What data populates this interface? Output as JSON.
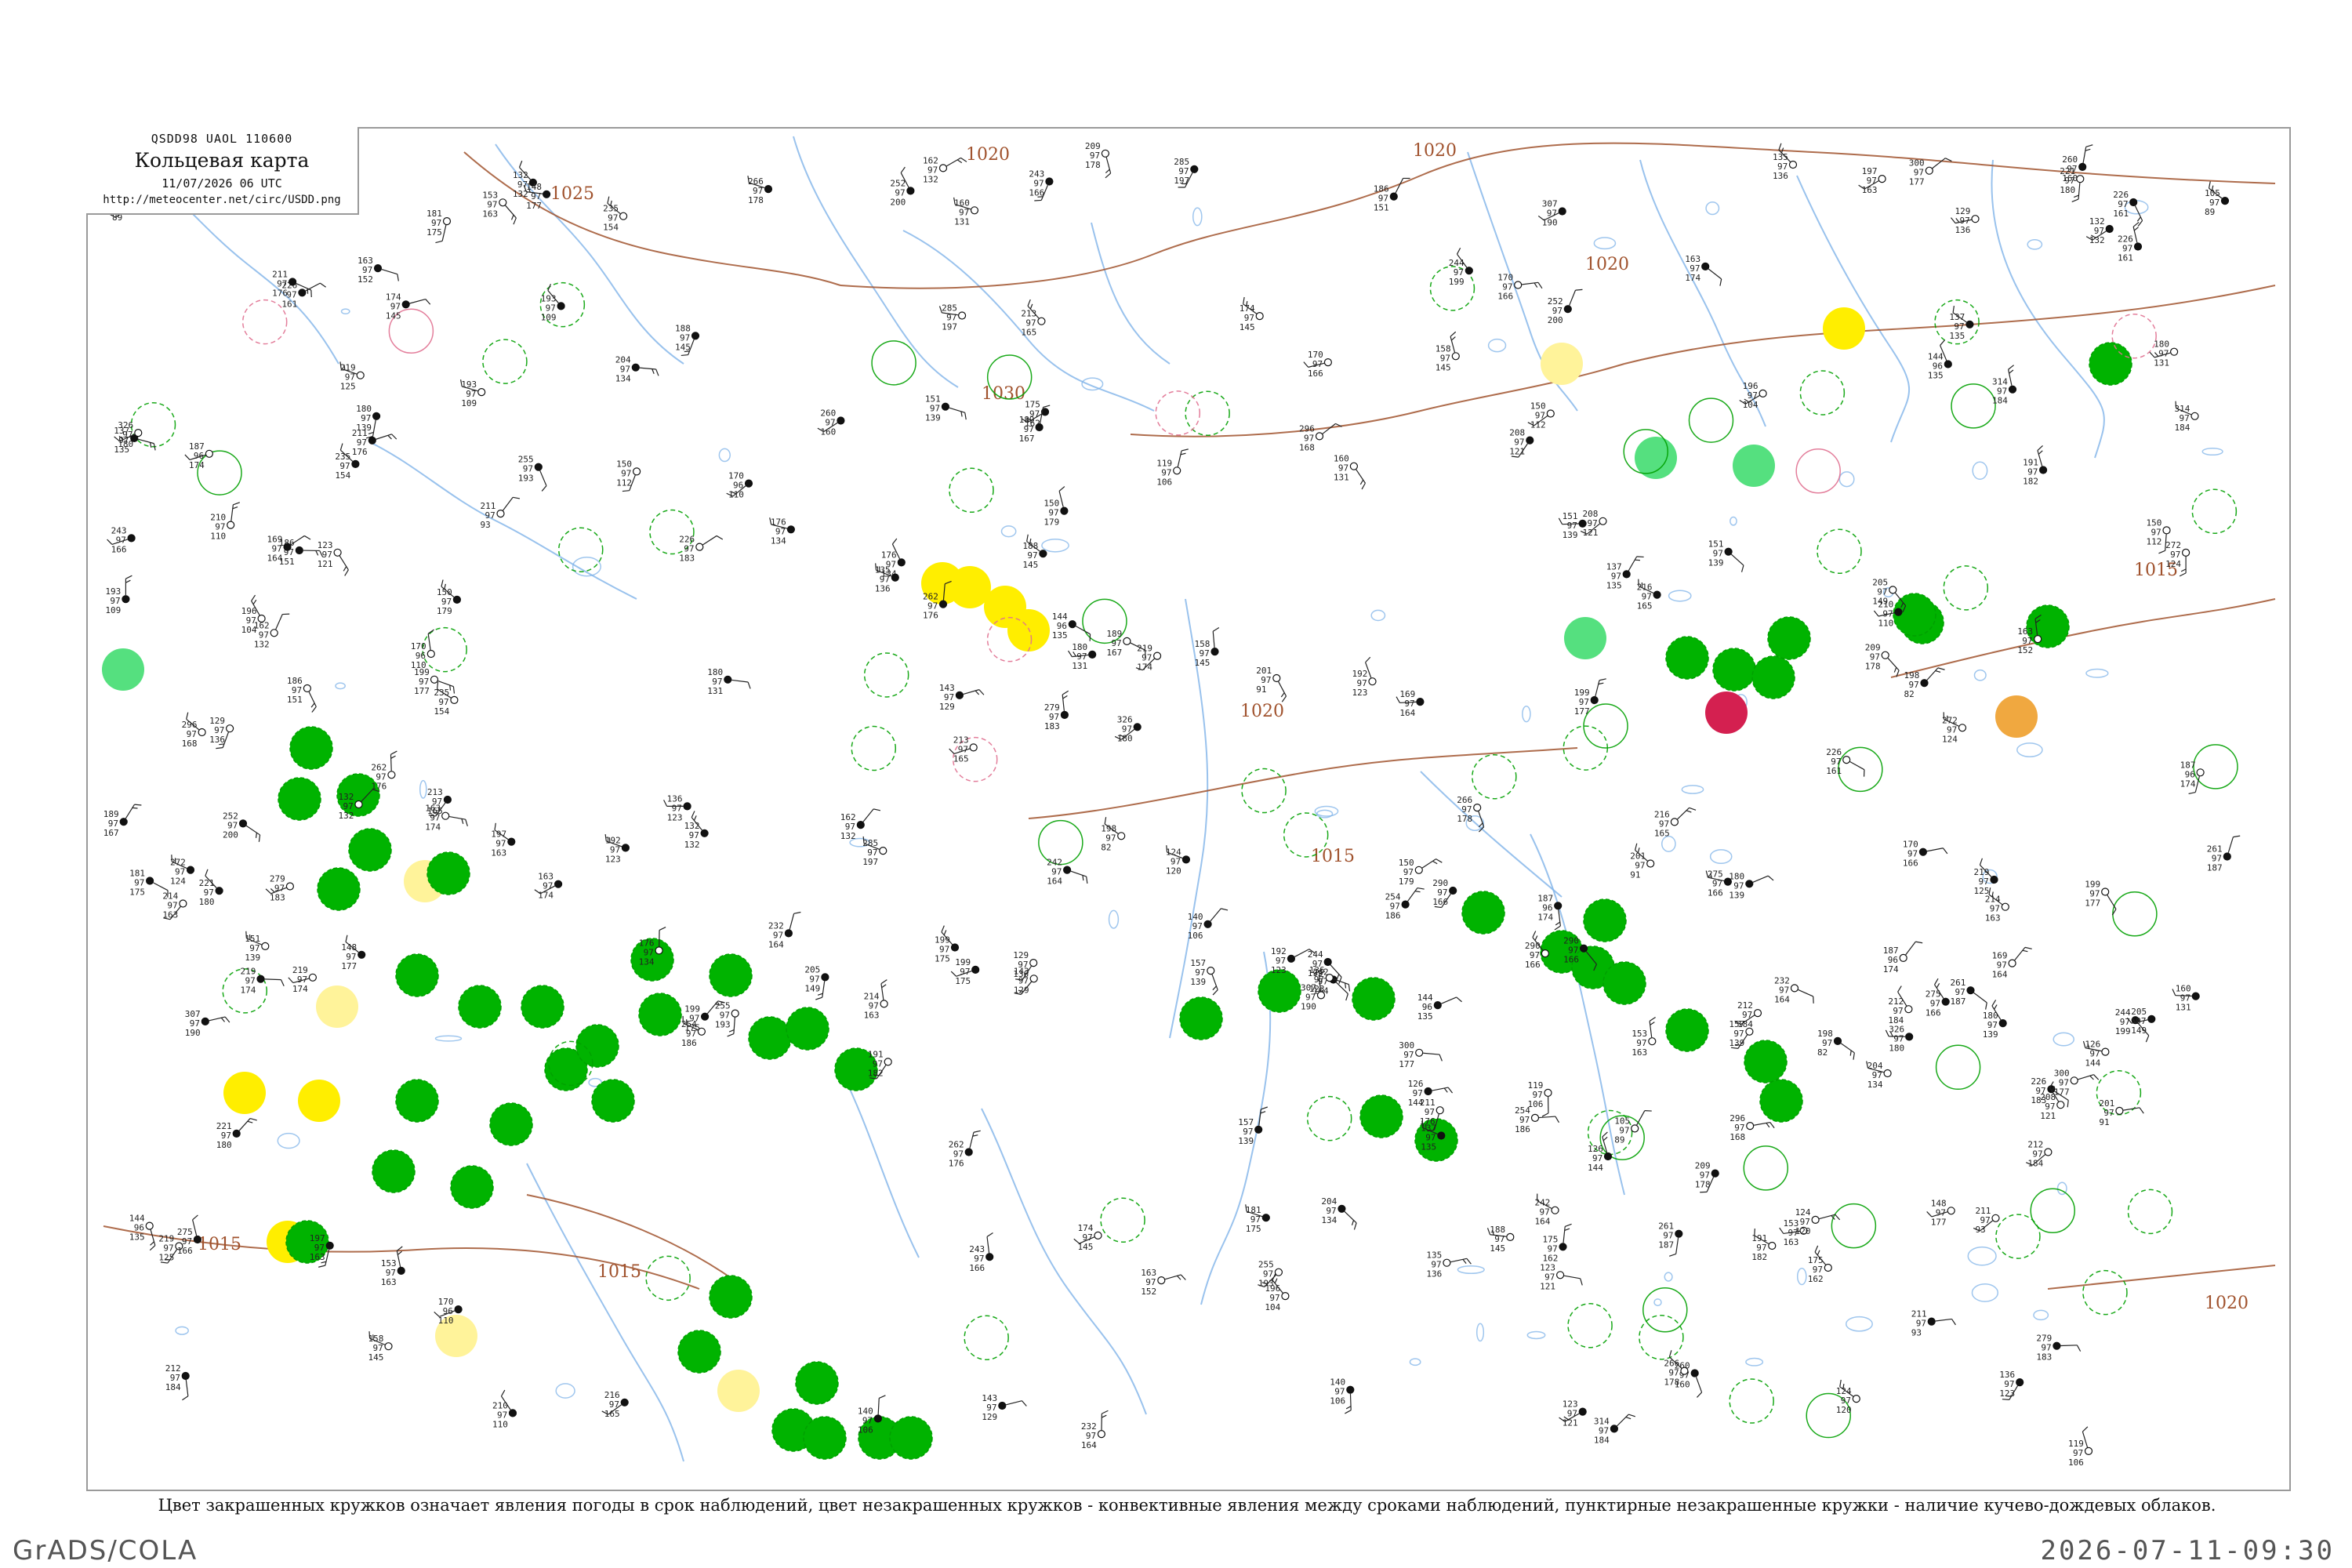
{
  "header": {
    "codes": "QSDD98  UAOL  110600",
    "title": "Кольцевая карта",
    "datetime": "11/07/2026 06 UTC",
    "url": "http://meteocenter.net/circ/USDD.png"
  },
  "caption": "Цвет закрашенных кружков означает явления погоды в срок наблюдений, цвет незакрашенных кружков - конвективные явления между сроками наблюдений, пунктирные незакрашенные кружки - наличие кучево-дождевых облаков.",
  "footer": {
    "left": "GrADS/COLA",
    "right": "2026-07-11-09:30"
  },
  "isobars": [
    "1020",
    "1025",
    "1020",
    "1030",
    "1020",
    "1015",
    "1020",
    "1015",
    "1015",
    "1015",
    "1020"
  ],
  "colors": {
    "background": "#ffffff",
    "border": "#9a9a9a",
    "isobar": "#a0522d",
    "river": "#7fb3e8",
    "rain": "#00b300",
    "rain_outline": "#00a000",
    "fog": "#ffee00",
    "haze": "#fff39a",
    "shower_light": "#55e07f",
    "thunder": "#d42050",
    "dust": "#f0a840",
    "thunder_outline": "#e07090",
    "station_text": "#222222",
    "place_text": "#777777"
  },
  "icons": {
    "station": "station-plot-icon",
    "wind_barb": "wind-barb-icon"
  },
  "stations": [
    {
      "t": "151",
      "td": "97",
      "p": "139"
    },
    {
      "t": "137",
      "td": "97",
      "p": "135"
    },
    {
      "t": "144",
      "td": "96",
      "p": "135"
    },
    {
      "t": "212",
      "td": "97",
      "p": "184"
    },
    {
      "t": "226",
      "td": "97",
      "p": "161"
    },
    {
      "t": "153",
      "td": "97",
      "p": "163"
    },
    {
      "t": "187",
      "td": "96",
      "p": "174"
    },
    {
      "t": "132",
      "td": "97",
      "p": "132"
    },
    {
      "t": "204",
      "td": "97",
      "p": "134"
    },
    {
      "t": "135",
      "td": "97",
      "p": "136"
    },
    {
      "t": "148",
      "td": "97",
      "p": "177"
    },
    {
      "t": "163",
      "td": "97",
      "p": "174"
    },
    {
      "t": "180",
      "td": "97",
      "p": "131"
    },
    {
      "t": "157",
      "td": "97",
      "p": "139"
    },
    {
      "t": "158",
      "td": "97",
      "p": "145"
    },
    {
      "t": "119",
      "td": "97",
      "p": "106"
    },
    {
      "t": "126",
      "td": "97",
      "p": "144"
    },
    {
      "t": "170",
      "td": "96",
      "p": "110"
    },
    {
      "t": "150",
      "td": "97",
      "p": "179"
    },
    {
      "t": "199",
      "td": "97",
      "p": "177"
    },
    {
      "t": "232",
      "td": "97",
      "p": "164"
    },
    {
      "t": "242",
      "td": "97",
      "p": "164"
    },
    {
      "t": "170",
      "td": "97",
      "p": "166"
    },
    {
      "t": "193",
      "td": "97",
      "p": "109"
    },
    {
      "t": "205",
      "td": "97",
      "p": "149"
    },
    {
      "t": "261",
      "td": "97",
      "p": "187"
    },
    {
      "t": "262",
      "td": "97",
      "p": "176"
    },
    {
      "t": "285",
      "td": "97",
      "p": "197"
    },
    {
      "t": "181",
      "td": "97",
      "p": "175"
    },
    {
      "t": "189",
      "td": "97",
      "p": "167"
    },
    {
      "t": "219",
      "td": "97",
      "p": "174"
    },
    {
      "t": "213",
      "td": "97",
      "p": "165"
    },
    {
      "t": "197",
      "td": "97",
      "p": "163"
    },
    {
      "t": "226",
      "td": "97",
      "p": "183"
    },
    {
      "t": "180",
      "td": "97",
      "p": "139"
    },
    {
      "t": "175",
      "td": "97",
      "p": "162"
    },
    {
      "t": "254",
      "td": "97",
      "p": "186"
    },
    {
      "t": "209",
      "td": "97",
      "p": "178"
    },
    {
      "t": "163",
      "td": "97",
      "p": "152"
    },
    {
      "t": "252",
      "td": "97",
      "p": "200"
    },
    {
      "t": "211",
      "td": "97",
      "p": "176"
    },
    {
      "t": "214",
      "td": "97",
      "p": "163"
    },
    {
      "t": "150",
      "td": "97",
      "p": "112"
    },
    {
      "t": "105",
      "td": "97",
      "p": "89"
    },
    {
      "t": "123",
      "td": "97",
      "p": "121"
    },
    {
      "t": "211",
      "td": "97",
      "p": "93"
    },
    {
      "t": "201",
      "td": "97",
      "p": "91"
    },
    {
      "t": "192",
      "td": "97",
      "p": "123"
    },
    {
      "t": "196",
      "td": "97",
      "p": "104"
    },
    {
      "t": "198",
      "td": "97",
      "p": "82"
    },
    {
      "t": "140",
      "td": "97",
      "p": "106"
    },
    {
      "t": "266",
      "td": "97",
      "p": "178"
    },
    {
      "t": "216",
      "td": "97",
      "p": "165"
    },
    {
      "t": "300",
      "td": "97",
      "p": "177"
    },
    {
      "t": "307",
      "td": "97",
      "p": "190"
    },
    {
      "t": "314",
      "td": "97",
      "p": "184"
    },
    {
      "t": "326",
      "td": "97",
      "p": "180"
    },
    {
      "t": "296",
      "td": "97",
      "p": "168"
    },
    {
      "t": "290",
      "td": "97",
      "p": "166"
    },
    {
      "t": "243",
      "td": "97",
      "p": "166"
    },
    {
      "t": "275",
      "td": "97",
      "p": "166"
    },
    {
      "t": "272",
      "td": "97",
      "p": "124"
    },
    {
      "t": "260",
      "td": "97",
      "p": "160"
    },
    {
      "t": "244",
      "td": "97",
      "p": "199"
    },
    {
      "t": "255",
      "td": "97",
      "p": "193"
    },
    {
      "t": "279",
      "td": "97",
      "p": "183"
    },
    {
      "t": "221",
      "td": "97",
      "p": "180"
    },
    {
      "t": "191",
      "td": "97",
      "p": "182"
    },
    {
      "t": "186",
      "td": "97",
      "p": "151"
    },
    {
      "t": "169",
      "td": "97",
      "p": "164"
    },
    {
      "t": "176",
      "td": "97",
      "p": "134"
    },
    {
      "t": "162",
      "td": "97",
      "p": "132"
    },
    {
      "t": "143",
      "td": "97",
      "p": "129"
    },
    {
      "t": "124",
      "td": "97",
      "p": "120"
    },
    {
      "t": "129",
      "td": "97",
      "p": "136"
    },
    {
      "t": "136",
      "td": "97",
      "p": "123"
    },
    {
      "t": "174",
      "td": "97",
      "p": "145"
    },
    {
      "t": "160",
      "td": "97",
      "p": "131"
    },
    {
      "t": "199",
      "td": "97",
      "p": "175"
    },
    {
      "t": "210",
      "td": "97",
      "p": "110"
    },
    {
      "t": "219",
      "td": "97",
      "p": "125"
    },
    {
      "t": "235",
      "td": "97",
      "p": "154"
    },
    {
      "t": "208",
      "td": "97",
      "p": "121"
    },
    {
      "t": "188",
      "td": "97",
      "p": "145"
    }
  ]
}
